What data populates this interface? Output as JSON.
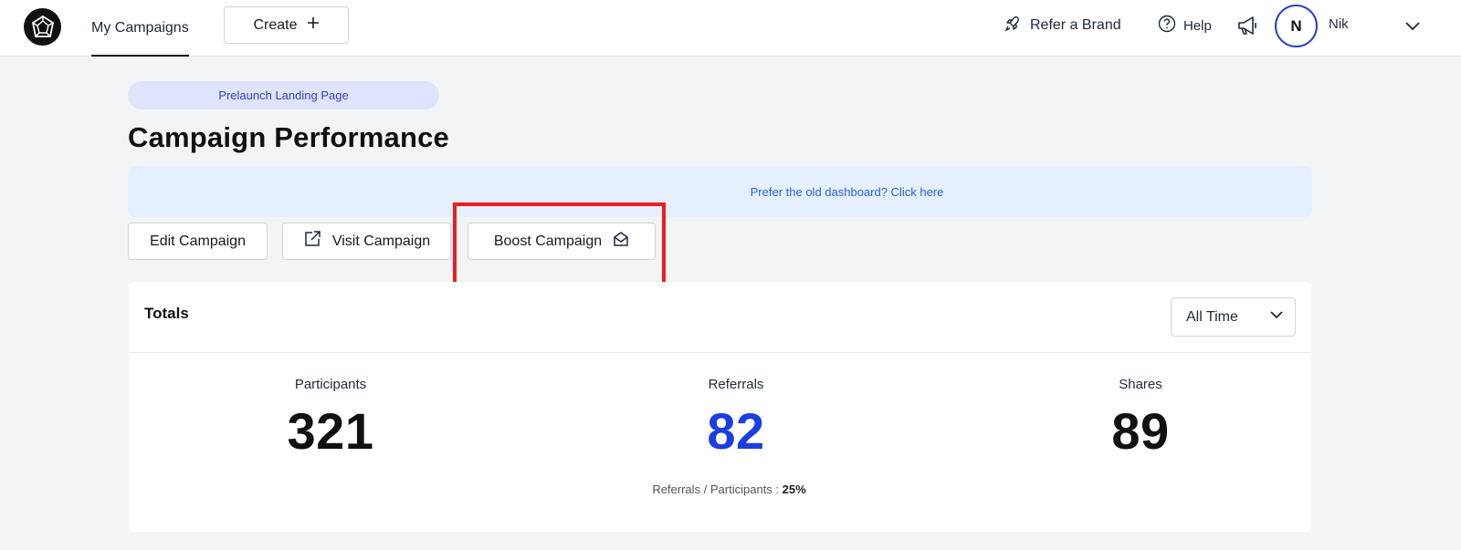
{
  "nav": {
    "tab": "My Campaigns",
    "create_label": "Create",
    "refer_label": "Refer a Brand",
    "help_label": "Help",
    "avatar_initial": "N",
    "user_name": "Nik"
  },
  "campaign": {
    "pill": "Prelaunch Landing Page",
    "title": "Campaign Performance",
    "banner_link": "Prefer the old dashboard? Click here"
  },
  "actions": {
    "edit": "Edit Campaign",
    "visit": "Visit Campaign",
    "boost": "Boost Campaign"
  },
  "totals": {
    "title": "Totals",
    "range": "All Time",
    "participants_label": "Participants",
    "participants_value": "321",
    "referrals_label": "Referrals",
    "referrals_value": "82",
    "shares_label": "Shares",
    "shares_value": "89",
    "ratio_label": "Referrals / Participants :",
    "ratio_value": "25%"
  },
  "colors": {
    "accent_blue": "#1a3fe0",
    "highlight_red": "#ee1c1c",
    "pill_bg": "#dfe3fb",
    "banner_bg": "#e6effd"
  },
  "icons": [
    "logo-icon",
    "plus-icon",
    "rocket-icon",
    "help-icon",
    "megaphone-icon",
    "chevron-down-icon",
    "external-link-icon",
    "envelope-open-icon"
  ]
}
